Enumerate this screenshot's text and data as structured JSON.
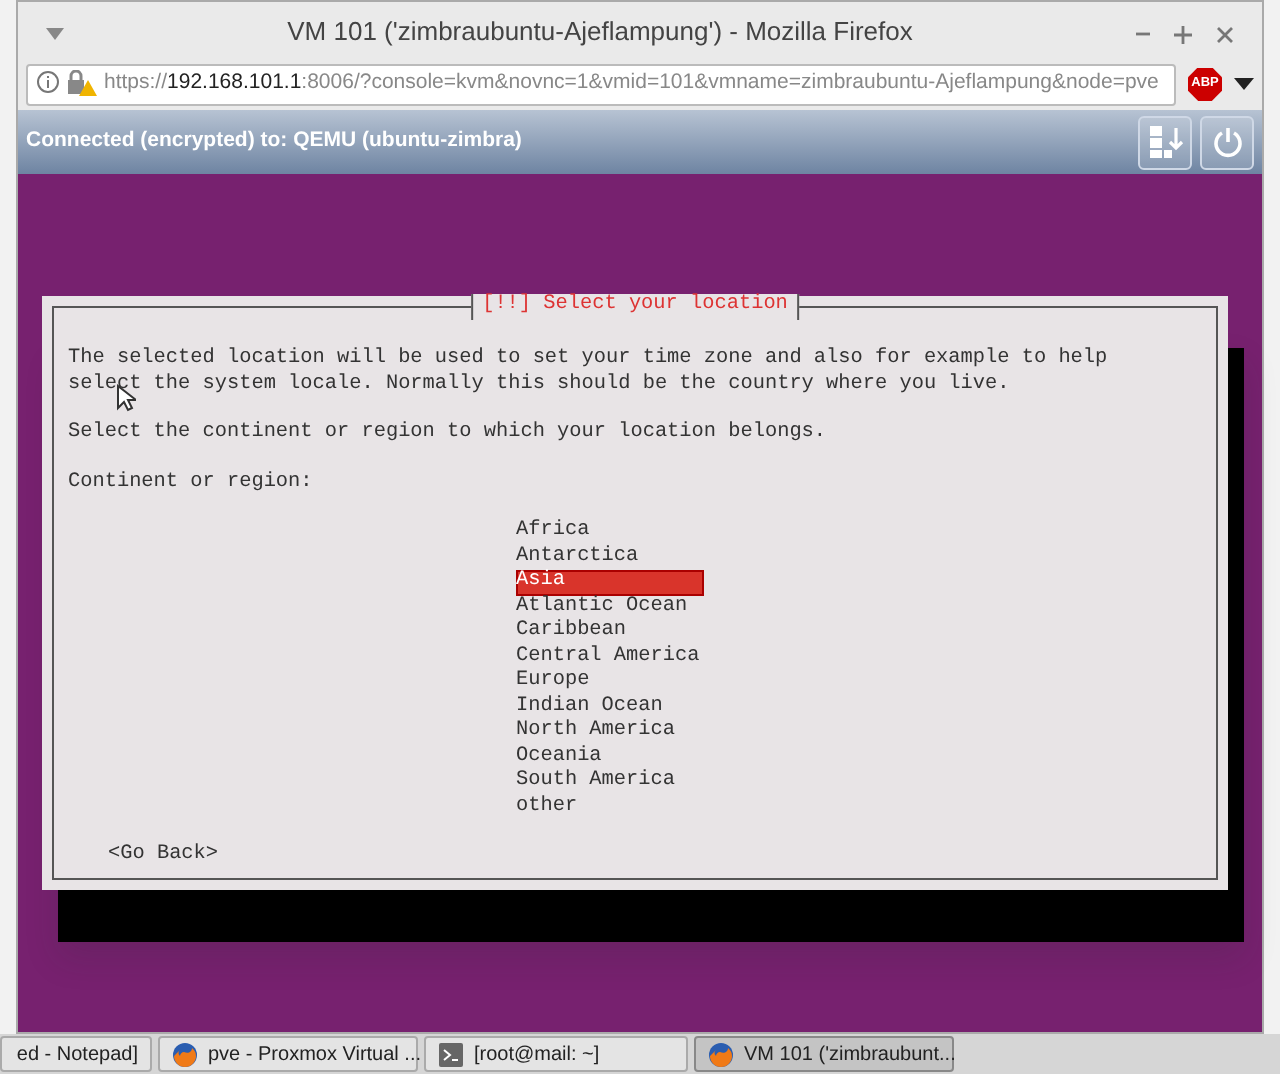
{
  "window": {
    "title": "VM 101 ('zimbraubuntu-Ajeflampung') - Mozilla Firefox"
  },
  "address_bar": {
    "url_prefix": "https://",
    "url_host": "192.168.101.1",
    "url_rest": ":8006/?console=kvm&novnc=1&vmid=101&vmname=zimbraubuntu-Ajeflampung&node=pve",
    "adblock_label": "ABP"
  },
  "vnc_bar": {
    "status": "Connected (encrypted) to: QEMU (ubuntu-zimbra)"
  },
  "dialog": {
    "title": "[!!] Select your location",
    "intro": "The selected location will be used to set your time zone and also for example to help\nselect the system locale. Normally this should be the country where you live.",
    "prompt": "Select the continent or region to which your location belongs.",
    "list_label": "Continent or region:",
    "options": [
      {
        "label": "Africa",
        "selected": false
      },
      {
        "label": "Antarctica",
        "selected": false
      },
      {
        "label": "Asia",
        "selected": true
      },
      {
        "label": "Atlantic Ocean",
        "selected": false
      },
      {
        "label": "Caribbean",
        "selected": false
      },
      {
        "label": "Central America",
        "selected": false
      },
      {
        "label": "Europe",
        "selected": false
      },
      {
        "label": "Indian Ocean",
        "selected": false
      },
      {
        "label": "North America",
        "selected": false
      },
      {
        "label": "Oceania",
        "selected": false
      },
      {
        "label": "South America",
        "selected": false
      },
      {
        "label": "other",
        "selected": false
      }
    ],
    "back_button": "<Go Back>"
  },
  "taskbar": [
    {
      "label": "ed - Notepad]",
      "kind": "plain",
      "selected": false
    },
    {
      "label": "pve - Proxmox Virtual ...",
      "kind": "browser",
      "selected": false
    },
    {
      "label": "[root@mail: ~]",
      "kind": "terminal",
      "selected": false
    },
    {
      "label": "VM 101 ('zimbraubunt...",
      "kind": "browser",
      "selected": true
    }
  ]
}
